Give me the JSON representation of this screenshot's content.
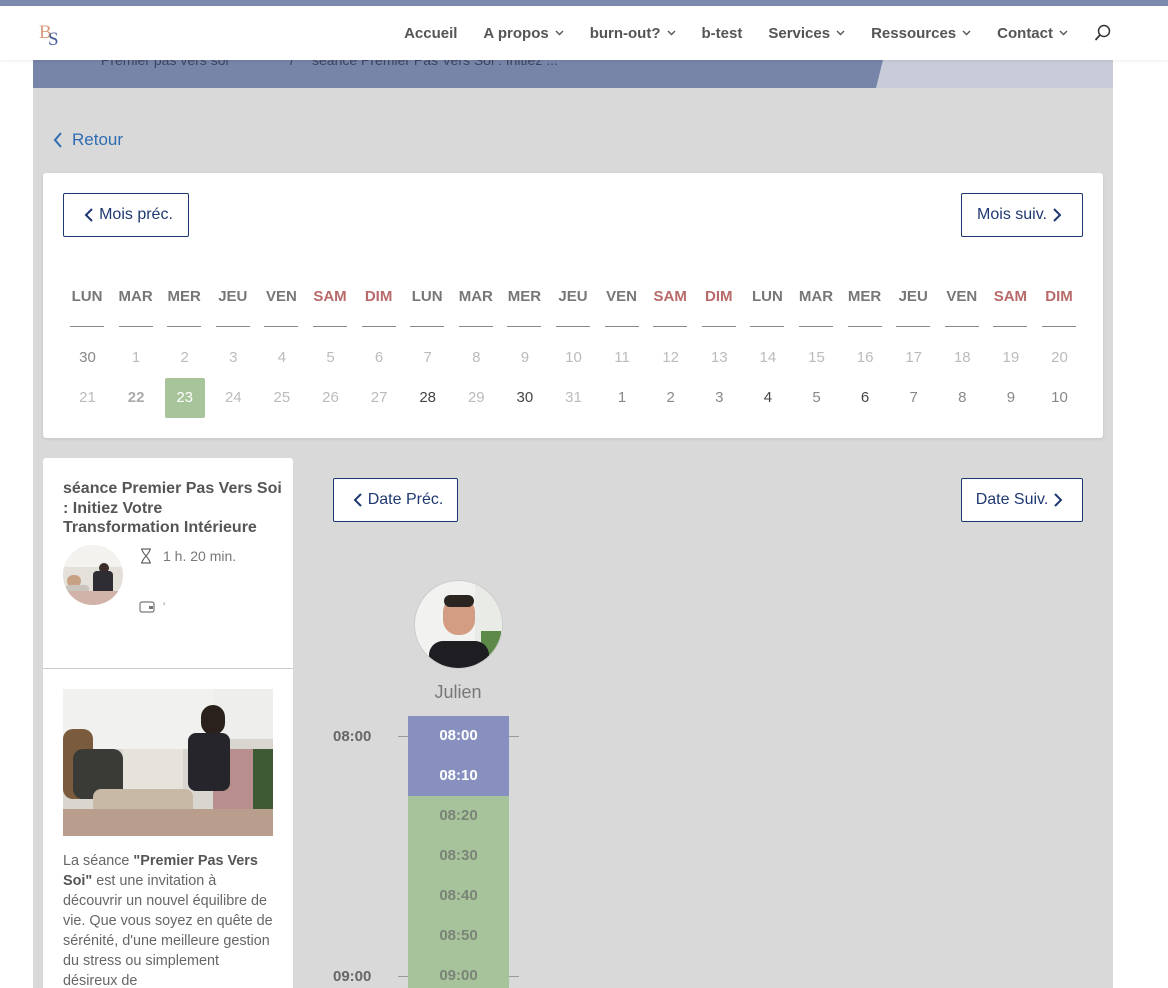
{
  "header": {
    "logo_text": "BS",
    "nav": [
      {
        "label": "Accueil",
        "dropdown": false
      },
      {
        "label": "A propos",
        "dropdown": true
      },
      {
        "label": "burn-out?",
        "dropdown": true
      },
      {
        "label": "b-test",
        "dropdown": false
      },
      {
        "label": "Services",
        "dropdown": true
      },
      {
        "label": "Ressources",
        "dropdown": true
      },
      {
        "label": "Contact",
        "dropdown": true
      }
    ]
  },
  "breadcrumb": {
    "item1": "Premier pas vers soi",
    "separator": "/",
    "item2": "séance Premier Pas Vers Soi : Initiez ..."
  },
  "back_label": "Retour",
  "calendar": {
    "prev_month_label": "Mois préc.",
    "next_month_label": "Mois suiv.",
    "weekdays": [
      "LUN",
      "MAR",
      "MER",
      "JEU",
      "VEN",
      "SAM",
      "DIM",
      "LUN",
      "MAR",
      "MER",
      "JEU",
      "VEN",
      "SAM",
      "DIM",
      "LUN",
      "MAR",
      "MER",
      "JEU",
      "VEN",
      "SAM",
      "DIM"
    ],
    "weekend_color": "#b86a6a",
    "row1": [
      "30",
      "1",
      "2",
      "3",
      "4",
      "5",
      "6",
      "7",
      "8",
      "9",
      "10",
      "11",
      "12",
      "13",
      "14",
      "15",
      "16",
      "17",
      "18",
      "19",
      "20"
    ],
    "row2": [
      "21",
      "22",
      "23",
      "24",
      "25",
      "26",
      "27",
      "28",
      "29",
      "30",
      "31",
      "1",
      "2",
      "3",
      "4",
      "5",
      "6",
      "7",
      "8",
      "9",
      "10"
    ],
    "selected_day": "23",
    "selected_color": "#a8c49a"
  },
  "service": {
    "title": "séance Premier Pas Vers Soi : Initiez Votre Transformation Intérieure",
    "duration": "1 h. 20 min.",
    "price": "'",
    "desc_prefix": "La séance ",
    "desc_bold": "\"Premier Pas Vers Soi\"",
    "desc_rest": " est une invitation à découvrir un nouvel équilibre de vie. Que vous soyez en quête de sérénité, d'une meilleure gestion du stress ou simplement désireux de"
  },
  "day_nav": {
    "prev_label": "Date Préc.",
    "next_label": "Date Suiv."
  },
  "staff": {
    "name": "Julien"
  },
  "timeline": {
    "hours": [
      "08:00",
      "09:00"
    ],
    "slots": [
      {
        "time": "08:00",
        "status": "busy"
      },
      {
        "time": "08:10",
        "status": "busy"
      },
      {
        "time": "08:20",
        "status": "free"
      },
      {
        "time": "08:30",
        "status": "free"
      },
      {
        "time": "08:40",
        "status": "free"
      },
      {
        "time": "08:50",
        "status": "free"
      },
      {
        "time": "09:00",
        "status": "free"
      }
    ],
    "busy_color": "#8890bf",
    "free_color": "#a7c39b"
  }
}
